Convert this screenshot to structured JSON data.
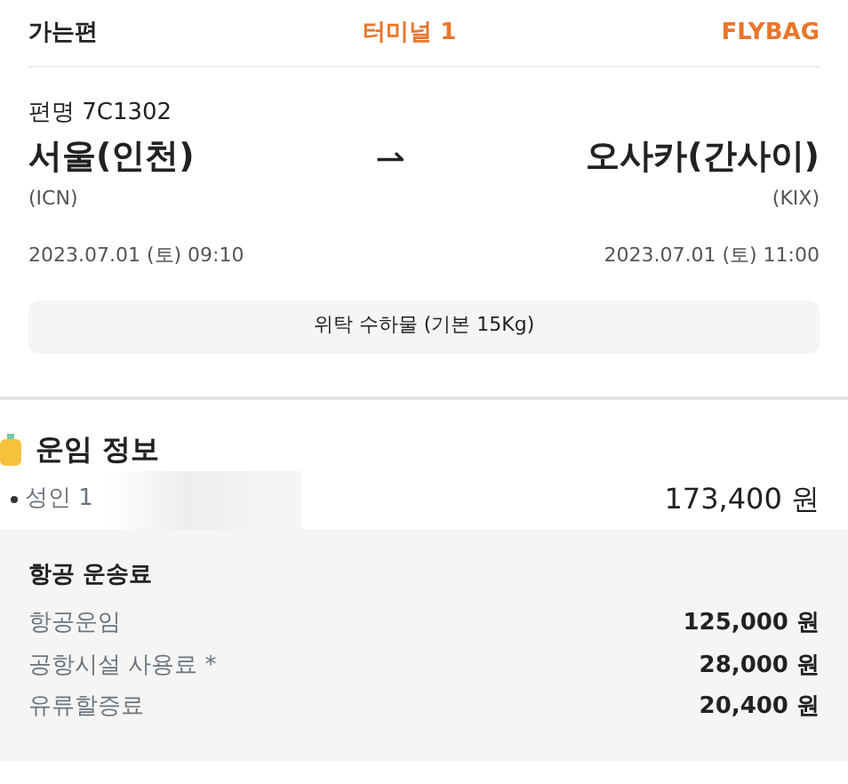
{
  "header": {
    "title": "가는편",
    "terminal": "터미널 1",
    "fare_type": "FLYBAG"
  },
  "flight": {
    "number_label": "편명 7C1302",
    "arrow": "⇀",
    "departure": {
      "city": "서울(인천)",
      "code": "(ICN)",
      "datetime": "2023.07.01 (토) 09:10"
    },
    "arrival": {
      "city": "오사카(간사이)",
      "code": "(KIX)",
      "datetime": "2023.07.01 (토) 11:00"
    }
  },
  "baggage": {
    "label": "위탁 수하물 (기본 15Kg)"
  },
  "fare": {
    "title": "운임 정보",
    "passenger": "성인 1",
    "total": "173,400 원",
    "breakdown": {
      "title": "항공 운송료",
      "items": [
        {
          "label": "항공운임",
          "amount": "125,000 원"
        },
        {
          "label": "공항시설 사용료 *",
          "amount": "28,000 원"
        },
        {
          "label": "유류할증료",
          "amount": "20,400 원"
        }
      ]
    }
  }
}
